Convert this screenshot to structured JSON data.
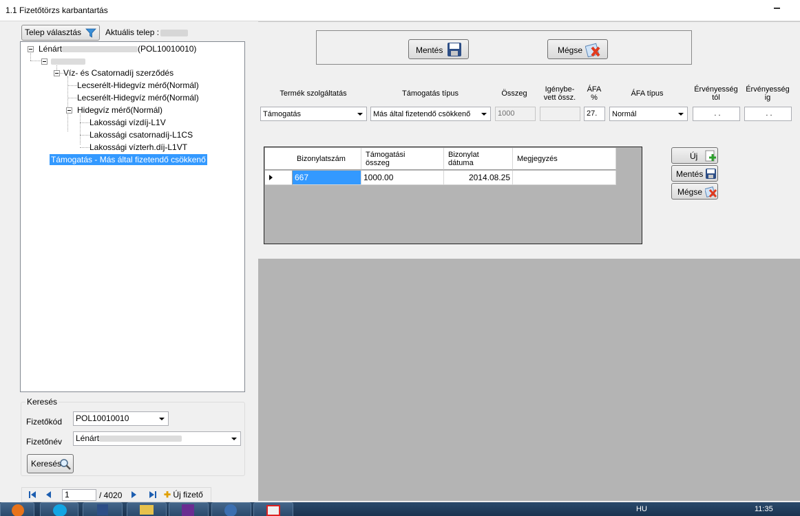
{
  "window": {
    "title": "1.1 Fizetőtörzs karbantartás"
  },
  "left": {
    "telep_button": "Telep választás",
    "aktualis_label": "Aktuális telep :",
    "tree": {
      "root_prefix": "Lénárt",
      "root_suffix": "(POL10010010)",
      "contract": "Víz- és Csatornadíj szerződés",
      "meter1": "Lecserélt-Hidegvíz mérő(Normál)",
      "meter2": "Lecserélt-Hidegvíz mérő(Normál)",
      "meter3": "Hidegvíz mérő(Normál)",
      "tariff1": "Lakossági vízdíj-L1V",
      "tariff2": "Lakossági csatornadíj-L1CS",
      "tariff3": "Lakossági vízterh.díj-L1VT",
      "support": "Támogatás - Más által fizetendő csökkenő"
    },
    "search": {
      "legend": "Keresés",
      "code_label": "Fizetőkód",
      "code_value": "POL10010010",
      "name_label": "Fizetőnév",
      "name_value": "Lénárt",
      "button": "Keresés"
    },
    "navigator": {
      "position": "1",
      "count": "/ 4020",
      "new_payer": "Új fizető"
    }
  },
  "right": {
    "save_button": "Mentés",
    "cancel_button": "Mégse",
    "headers": {
      "product": "Termék szolgáltatás",
      "support_type": "Támogatás típus",
      "amount": "Összeg",
      "claimed_1": "Igénybe-",
      "claimed_2": "vett össz.",
      "vat_1": "ÁFA",
      "vat_2": "%",
      "vat_type": "ÁFA típus",
      "valid_from_1": "Érvényesség",
      "valid_from_2": "tól",
      "valid_to_1": "Érvényesség",
      "valid_to_2": "ig"
    },
    "fields": {
      "product": "Támogatás",
      "support_type": "Más által fizetendő csökkenő",
      "amount": "1000",
      "claimed": "",
      "vat": "27.",
      "vat_type": "Normál",
      "valid_from": ". .",
      "valid_to": ". ."
    },
    "grid": {
      "columns": {
        "doc_no": "Bizonylatszám",
        "support_amount_1": "Támogatási",
        "support_amount_2": "összeg",
        "doc_date_1": "Bizonylat",
        "doc_date_2": "dátuma",
        "note": "Megjegyzés"
      },
      "rows": [
        {
          "doc_no": "667",
          "amount": "1000.00",
          "date": "2014.08.25",
          "note": ""
        }
      ]
    },
    "side_buttons": {
      "new": "Új",
      "save": "Mentés",
      "cancel": "Mégse"
    }
  },
  "taskbar": {
    "language": "HU",
    "time": "11:35"
  },
  "colors": {
    "selection": "#3399ff",
    "gray_area": "#b4b4b4"
  }
}
